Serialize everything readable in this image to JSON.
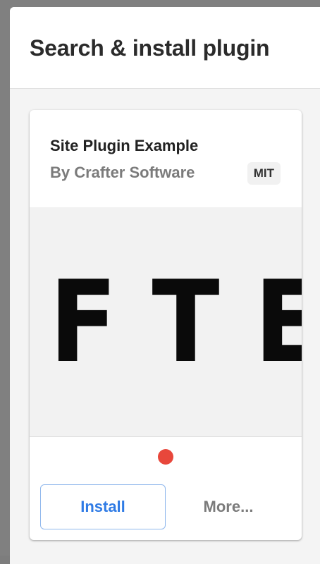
{
  "dialog": {
    "title": "Search & install plugin"
  },
  "plugin_card": {
    "title": "Site Plugin Example",
    "author": "By Crafter Software",
    "license": "MIT",
    "preview_text": "FTER",
    "carousel": {
      "dots": 1,
      "active_color": "#e8473b"
    },
    "actions": {
      "install_label": "Install",
      "more_label": "More..."
    }
  },
  "colors": {
    "accent": "#2f7be5",
    "install_border": "#8fb7ec",
    "muted_text": "#7b7b7b"
  }
}
